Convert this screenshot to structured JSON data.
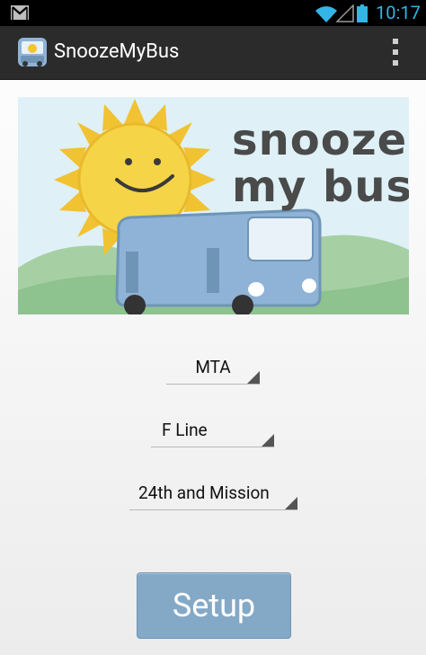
{
  "status_bar": {
    "time": "10:17",
    "time_color": "#33b5e5"
  },
  "action_bar": {
    "title": "SnoozeMyBus"
  },
  "banner": {
    "logo_line1": "snooze",
    "logo_line2": "my bus"
  },
  "spinners": {
    "agency": "MTA",
    "line": "F Line",
    "stop": "24th and Mission"
  },
  "setup_button": {
    "label": "Setup",
    "color": "#84a9c7"
  },
  "icons": [
    "gmail-icon",
    "wifi-icon",
    "signal-icon",
    "battery-icon",
    "app-bus-icon",
    "overflow-menu-icon",
    "dropdown-triangle-icon"
  ]
}
